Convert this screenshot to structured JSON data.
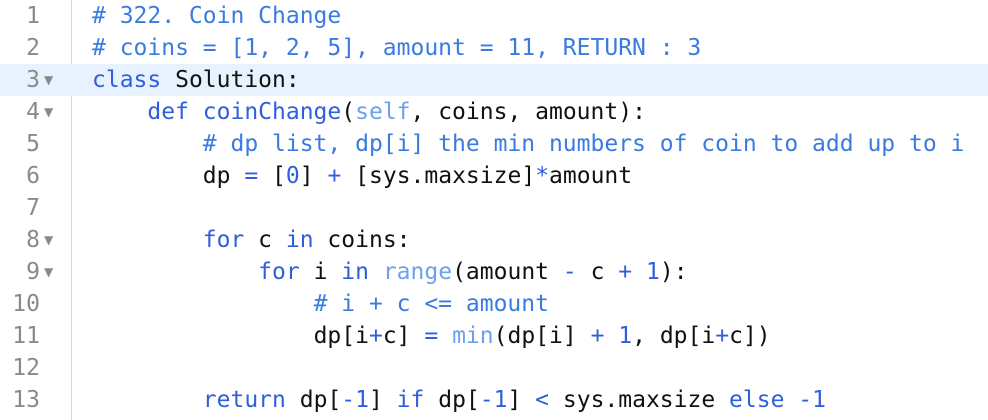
{
  "editor": {
    "lines": [
      {
        "number": "1",
        "fold": ""
      },
      {
        "number": "2",
        "fold": ""
      },
      {
        "number": "3",
        "fold": "▼"
      },
      {
        "number": "4",
        "fold": "▼"
      },
      {
        "number": "5",
        "fold": ""
      },
      {
        "number": "6",
        "fold": ""
      },
      {
        "number": "7",
        "fold": ""
      },
      {
        "number": "8",
        "fold": "▼"
      },
      {
        "number": "9",
        "fold": "▼"
      },
      {
        "number": "10",
        "fold": ""
      },
      {
        "number": "11",
        "fold": ""
      },
      {
        "number": "12",
        "fold": ""
      },
      {
        "number": "13",
        "fold": ""
      }
    ],
    "tokens": {
      "l1_comment": "# 322. Coin Change",
      "l2_comment": "# coins = [1, 2, 5], amount = 11, RETURN : 3",
      "l3_kw": "class",
      "l3_name": " Solution:",
      "l4_indent": "    ",
      "l4_kw": "def",
      "l4_fn": " coinChange",
      "l4_p1": "(",
      "l4_self": "self",
      "l4_rest": ", coins, amount):",
      "l5_indent": "        ",
      "l5_comment": "# dp list, dp[i] the min numbers of coin to add up to i",
      "l6_indent": "        ",
      "l6_a": "dp ",
      "l6_eq": "=",
      "l6_b": " [",
      "l6_zero": "0",
      "l6_c": "] ",
      "l6_plus": "+",
      "l6_d": " [sys.maxsize]",
      "l6_star": "*",
      "l6_e": "amount",
      "l8_indent": "        ",
      "l8_for": "for",
      "l8_a": " c ",
      "l8_in": "in",
      "l8_b": " coins:",
      "l9_indent": "            ",
      "l9_for": "for",
      "l9_a": " i ",
      "l9_in": "in",
      "l9_sp": " ",
      "l9_range": "range",
      "l9_b": "(amount ",
      "l9_minus": "-",
      "l9_c": " c ",
      "l9_plus": "+",
      "l9_sp2": " ",
      "l9_one": "1",
      "l9_d": "):",
      "l10_indent": "                ",
      "l10_comment": "# i + c <= amount",
      "l11_indent": "                ",
      "l11_a": "dp[i",
      "l11_plus1": "+",
      "l11_b": "c] ",
      "l11_eq": "=",
      "l11_sp": " ",
      "l11_min": "min",
      "l11_c": "(dp[i] ",
      "l11_plus2": "+",
      "l11_sp2": " ",
      "l11_one": "1",
      "l11_d": ", dp[i",
      "l11_plus3": "+",
      "l11_e": "c])",
      "l13_indent": "        ",
      "l13_return": "return",
      "l13_a": " dp[",
      "l13_neg1": "-1",
      "l13_b": "] ",
      "l13_if": "if",
      "l13_c": " dp[",
      "l13_neg2": "-1",
      "l13_d": "] ",
      "l13_lt": "<",
      "l13_e": " sys.maxsize ",
      "l13_else": "else",
      "l13_sp": " ",
      "l13_neg3": "-1"
    }
  }
}
